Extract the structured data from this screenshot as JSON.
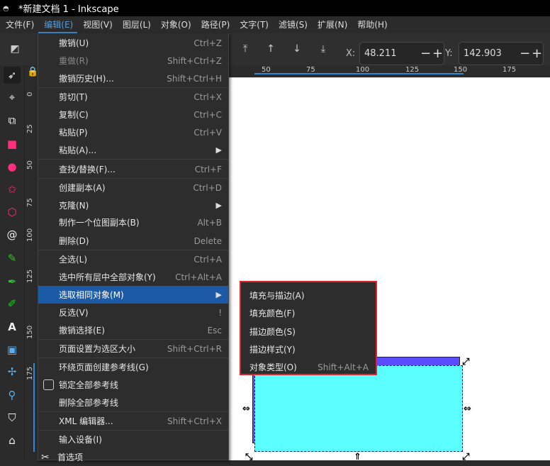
{
  "window": {
    "title": "*新建文档 1 - Inkscape"
  },
  "menubar": [
    "文件(F)",
    "编辑(E)",
    "视图(V)",
    "图层(L)",
    "对象(O)",
    "路径(P)",
    "文字(T)",
    "滤镜(S)",
    "扩展(N)",
    "帮助(H)"
  ],
  "toolbar": {
    "x_label": "X:",
    "x_value": "48.211",
    "y_label": "Y:",
    "y_value": "142.903",
    "minus": "−",
    "plus": "+"
  },
  "rulers": {
    "top": [
      "50",
      "75",
      "100",
      "125",
      "150",
      "175"
    ],
    "left": [
      "0",
      "25",
      "50",
      "75",
      "100",
      "125",
      "150",
      "175"
    ]
  },
  "edit_menu": [
    {
      "label": "撤销(U)",
      "shortcut": "Ctrl+Z"
    },
    {
      "label": "重做(R)",
      "shortcut": "Shift+Ctrl+Z",
      "disabled": true
    },
    {
      "label": "撤销历史(H)...",
      "shortcut": "Shift+Ctrl+H"
    },
    {
      "label": "剪切(T)",
      "shortcut": "Ctrl+X"
    },
    {
      "label": "复制(C)",
      "shortcut": "Ctrl+C"
    },
    {
      "label": "粘贴(P)",
      "shortcut": "Ctrl+V"
    },
    {
      "label": "粘贴(A)...",
      "submenu": true
    },
    {
      "label": "查找/替换(F)...",
      "shortcut": "Ctrl+F"
    },
    {
      "label": "创建副本(A)",
      "shortcut": "Ctrl+D"
    },
    {
      "label": "克隆(N)",
      "submenu": true
    },
    {
      "label": "制作一个位图副本(B)",
      "shortcut": "Alt+B"
    },
    {
      "label": "删除(D)",
      "shortcut": "Delete"
    },
    {
      "label": "全选(L)",
      "shortcut": "Ctrl+A"
    },
    {
      "label": "选中所有层中全部对象(Y)",
      "shortcut": "Ctrl+Alt+A"
    },
    {
      "label": "选取相同对象(M)",
      "submenu": true,
      "highlighted": true
    },
    {
      "label": "反选(V)",
      "shortcut": "!"
    },
    {
      "label": "撤销选择(E)",
      "shortcut": "Esc"
    },
    {
      "label": "页面设置为选区大小",
      "shortcut": "Shift+Ctrl+R"
    },
    {
      "label": "环绕页面创建参考线(G)"
    },
    {
      "label": "锁定全部参考线",
      "checkbox": true
    },
    {
      "label": "删除全部参考线"
    },
    {
      "label": "XML 编辑器...",
      "shortcut": "Shift+Ctrl+X"
    },
    {
      "label": "输入设备(I)"
    },
    {
      "label": "首选项"
    }
  ],
  "select_same_submenu": [
    {
      "label": "填充与描边(A)"
    },
    {
      "label": "填充颜色(F)"
    },
    {
      "label": "描边颜色(S)"
    },
    {
      "label": "描边样式(Y)"
    },
    {
      "label": "对象类型(O)",
      "shortcut": "Shift+Alt+A"
    }
  ],
  "colors": {
    "accent": "#1c5aa6",
    "highlight_border": "#e8202a",
    "rect_back": "#5a4dff",
    "rect_front": "#5bffff"
  }
}
